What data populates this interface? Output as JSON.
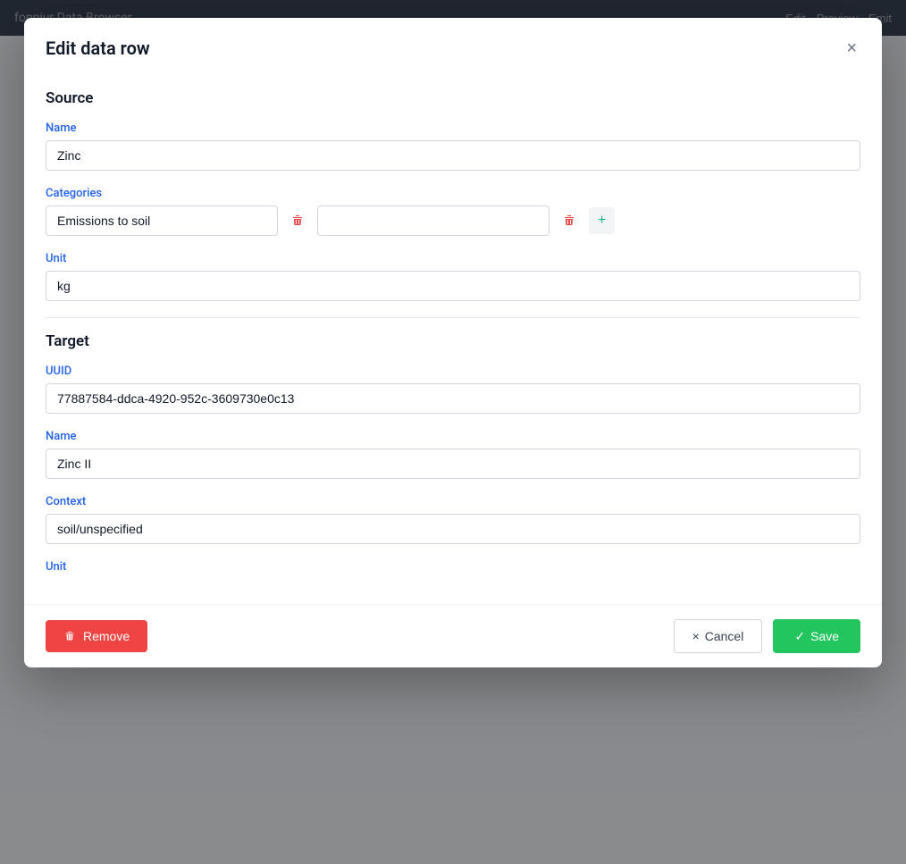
{
  "app": {
    "title": "fonniur Data Browser",
    "top_actions": [
      "Edit",
      "Preview",
      "Emit"
    ]
  },
  "modal": {
    "title": "Edit data row",
    "close_label": "×",
    "source_section": "Source",
    "target_section": "Target",
    "source": {
      "name_label": "Name",
      "name_value": "Zinc",
      "categories_label": "Categories",
      "category1_value": "Emissions to soil",
      "category2_value": "",
      "unit_label": "Unit",
      "unit_value": "kg"
    },
    "target": {
      "uuid_label": "UUID",
      "uuid_value": "77887584-ddca-4920-952c-3609730e0c13",
      "name_label": "Name",
      "name_value": "Zinc II",
      "context_label": "Context",
      "context_value": "soil/unspecified",
      "unit_label": "Unit",
      "unit_value": ""
    },
    "buttons": {
      "remove_label": "Remove",
      "cancel_label": "Cancel",
      "save_label": "Save"
    }
  }
}
